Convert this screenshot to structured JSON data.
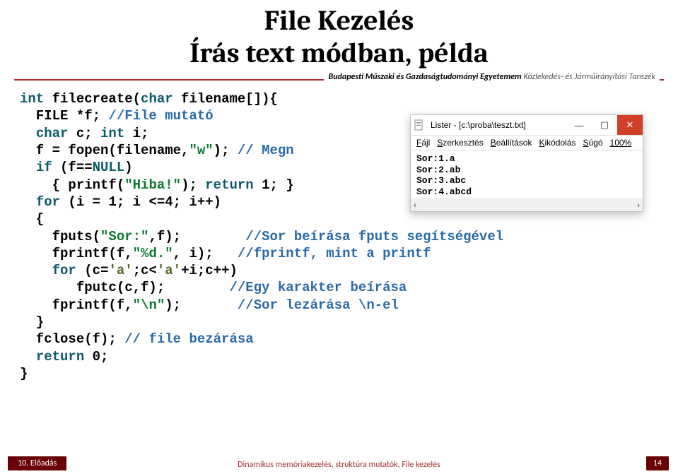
{
  "title_line1": "File Kezelés",
  "title_line2": "Írás text módban, példa",
  "divider": {
    "strong": "Budapesti Műszaki és Gazdaságtudományi Egyetemem",
    "light": "Közlekedés- és Járműirányítási Tanszék"
  },
  "code": {
    "l1_a": "int",
    "l1_b": " filecreate(",
    "l1_c": "char",
    "l1_d": " filename[]){",
    "l2_a": "  FILE *f; ",
    "l2_b": "//File mutató",
    "l3_a": "  ",
    "l3_b": "char",
    "l3_c": " c; ",
    "l3_d": "int",
    "l3_e": " i;",
    "l4_a": "  f = fopen(filename,",
    "l4_b": "\"w\"",
    "l4_c": "); ",
    "l4_d": "// Megn",
    "l5_a": "  ",
    "l5_b": "if",
    "l5_c": " (f==",
    "l5_d": "NULL",
    "l5_e": ")",
    "l6_a": "    { printf(",
    "l6_b": "\"Hiba!\"",
    "l6_c": "); ",
    "l6_d": "return",
    "l6_e": " 1; }",
    "l7_a": "  ",
    "l7_b": "for",
    "l7_c": " (i = 1; i <=4; i++)",
    "l8": "  {",
    "l9_a": "    fputs(",
    "l9_b": "\"Sor:\"",
    "l9_c": ",f);",
    "l9_pad": "        ",
    "l9_d": "//Sor beírása fputs segítségével",
    "l10_a": "    fprintf(f,",
    "l10_b": "\"%d.\"",
    "l10_c": ", i);",
    "l10_pad": "   ",
    "l10_d": "//fprintf, mint a printf",
    "l11_a": "    ",
    "l11_b": "for",
    "l11_c": " (c=",
    "l11_d": "'a'",
    "l11_e": ";c<",
    "l11_f": "'a'",
    "l11_g": "+i;c++)",
    "l12_a": "       fputc(c,f);",
    "l12_pad": "        ",
    "l12_b": "//Egy karakter beírása",
    "l13_a": "    fprintf(f,",
    "l13_b": "\"\\n\"",
    "l13_c": ");",
    "l13_pad": "       ",
    "l13_d": "//Sor lezárása \\n-el",
    "l14": "  }",
    "l15_a": "  fclose(f); ",
    "l15_b": "// file bezárása",
    "l16_a": "  ",
    "l16_b": "return",
    "l16_c": " 0;",
    "l17": "}"
  },
  "lister": {
    "title": "Lister - [c:\\proba\\teszt.txt]",
    "menu": {
      "m1": "Fájl",
      "m2": "Szerkesztés",
      "m3": "Beállítások",
      "m4": "Kikódolás",
      "m5": "Súgó",
      "m6": "100%"
    },
    "lines": [
      "Sor:1.a",
      "Sor:2.ab",
      "Sor:3.abc",
      "Sor:4.abcd"
    ],
    "buttons": {
      "min": "—",
      "max": "▢",
      "close": "✕"
    },
    "scroll_left": "‹",
    "scroll_right": "›"
  },
  "footer": {
    "left": "10. Előadás",
    "mid": "Dinamikus memóriakezelés, struktúra mutatók, File kezelés",
    "right": "14"
  }
}
